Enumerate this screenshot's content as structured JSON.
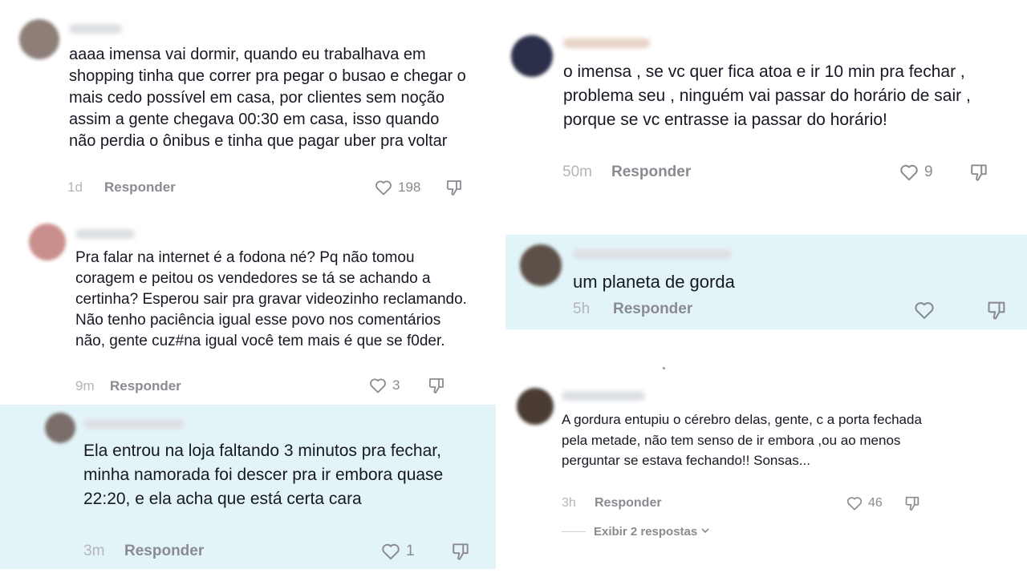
{
  "comments": [
    {
      "text": "aaaa imensa vai dormir, quando eu trabalhava em shopping tinha que correr pra pegar o busao e chegar o mais cedo possível em casa, por clientes sem noção assim a gente chegava 00:30 em casa, isso quando não perdia o ônibus e tinha que pagar uber pra voltar",
      "time": "1d",
      "reply": "Responder",
      "likes": "198",
      "avatar_color": "#8d7f78",
      "highlighted": false
    },
    {
      "text": "Pra falar na internet é a fodona né? Pq não tomou coragem e peitou os vendedores se tá se achando a certinha? Esperou sair pra gravar videozinho reclamando. Não tenho paciência igual esse povo nos comentários não, gente cuz#na igual você tem mais é que se f0der.",
      "time": "9m",
      "reply": "Responder",
      "likes": "3",
      "avatar_color": "#c98f8c",
      "highlighted": false
    },
    {
      "text": "Ela entrou na loja faltando 3 minutos pra fechar, minha namorada foi descer pra ir embora quase 22:20, e ela acha que está certa cara",
      "time": "3m",
      "reply": "Responder",
      "likes": "1",
      "avatar_color": "#7a6e6a",
      "highlighted": true
    },
    {
      "text": "o imensa , se vc quer fica atoa e ir 10 min pra fechar , problema seu , ninguém vai passar do horário de sair , porque se vc entrasse ia passar do horário!",
      "time": "50m",
      "reply": "Responder",
      "likes": "9",
      "avatar_color": "#2c2f4a",
      "highlighted": false
    },
    {
      "text": "um planeta de gorda",
      "time": "5h",
      "reply": "Responder",
      "likes": "",
      "avatar_color": "#5d5048",
      "highlighted": true
    },
    {
      "text": "A gordura entupiu o cérebro delas, gente, c a porta fechada pela metade, não tem senso de ir embora ,ou ao menos perguntar se estava fechando!! Sonsas...",
      "time": "3h",
      "reply": "Responder",
      "likes": "46",
      "avatar_color": "#4a3c34",
      "highlighted": false
    }
  ],
  "view_replies": "Exibir 2 respostas",
  "colors": {
    "highlight": "#e3f4f8",
    "meta_text": "#8a8b91",
    "text": "#161823"
  }
}
